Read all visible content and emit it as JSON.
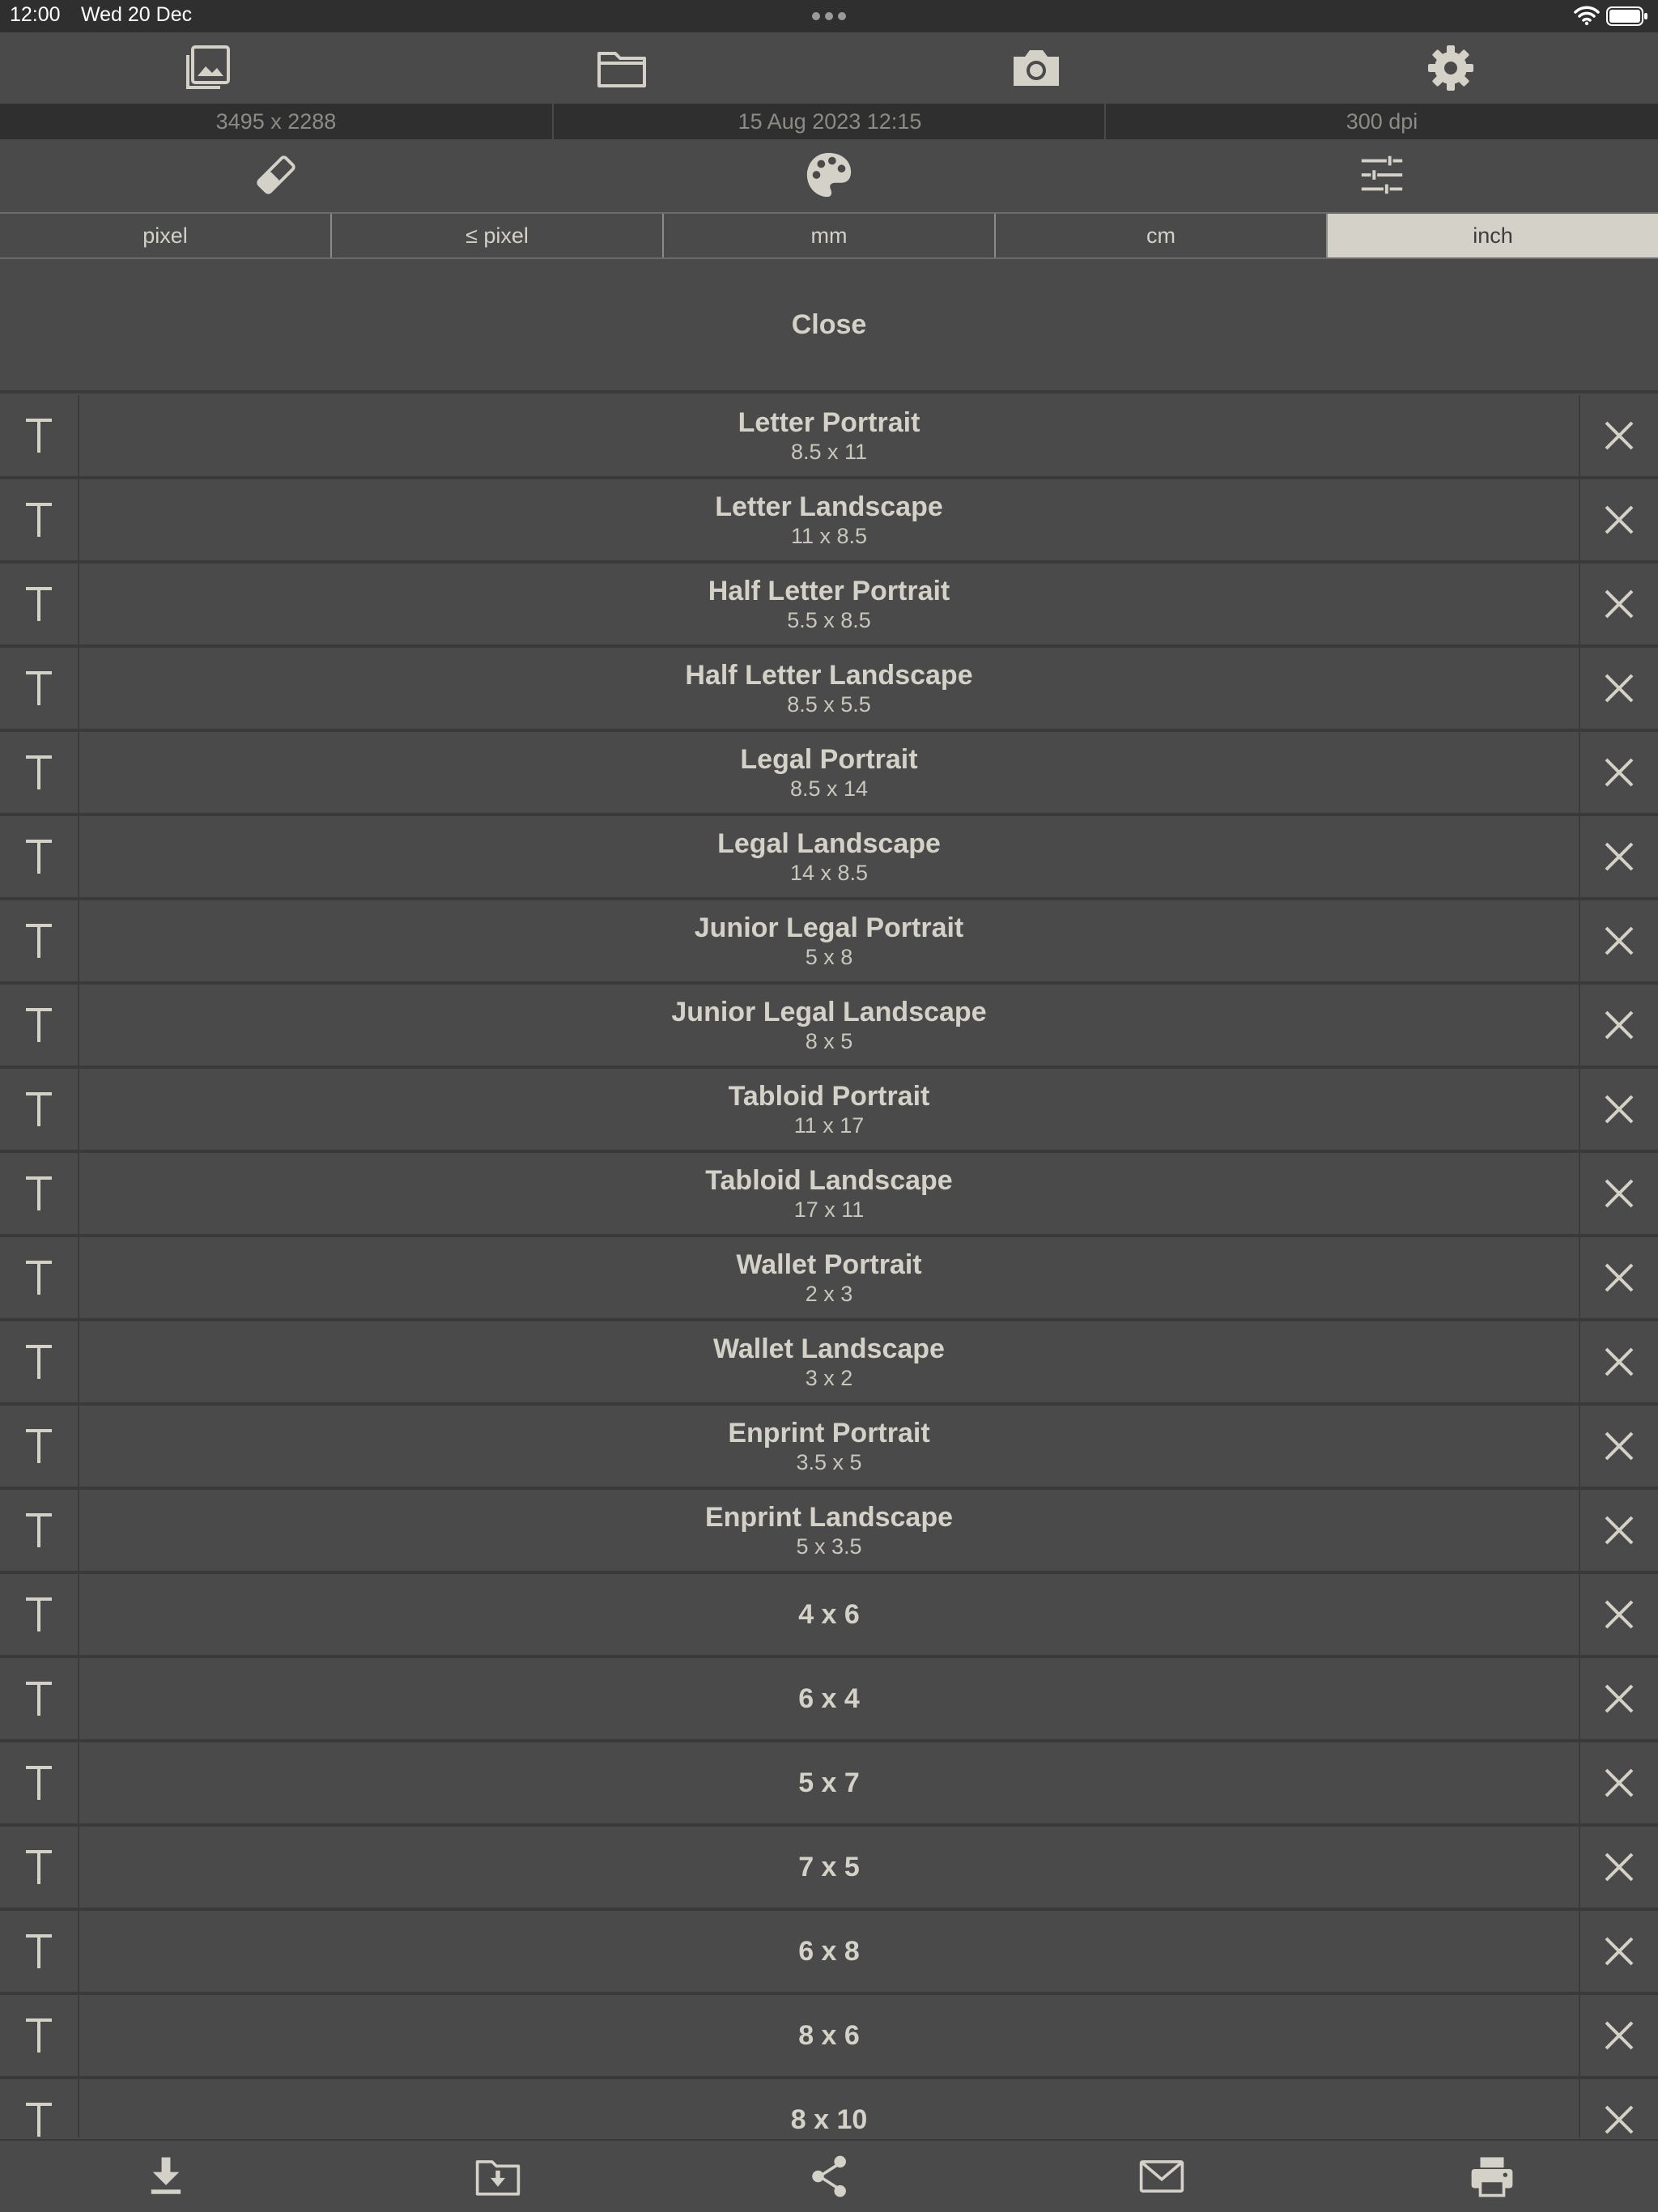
{
  "status_bar": {
    "time": "12:00",
    "date": "Wed 20 Dec"
  },
  "toolbar": {
    "icons": [
      "photo-library-icon",
      "folder-icon",
      "camera-icon",
      "settings-gear-icon"
    ]
  },
  "info_bar": {
    "dimensions": "3495 x 2288",
    "datetime": "15 Aug 2023 12:15",
    "resolution": "300 dpi"
  },
  "toolbar2": {
    "icons": [
      "eraser-icon",
      "palette-icon",
      "sliders-icon"
    ]
  },
  "units": {
    "options": [
      "pixel",
      "≤ pixel",
      "mm",
      "cm",
      "inch"
    ],
    "selected": "inch"
  },
  "close_label": "Close",
  "sizes": [
    {
      "name": "Letter Portrait",
      "dims": "8.5 x 11"
    },
    {
      "name": "Letter Landscape",
      "dims": "11 x 8.5"
    },
    {
      "name": "Half Letter Portrait",
      "dims": "5.5 x 8.5"
    },
    {
      "name": "Half Letter Landscape",
      "dims": "8.5 x 5.5"
    },
    {
      "name": "Legal Portrait",
      "dims": "8.5 x 14"
    },
    {
      "name": "Legal Landscape",
      "dims": "14 x 8.5"
    },
    {
      "name": "Junior Legal Portrait",
      "dims": "5 x 8"
    },
    {
      "name": "Junior Legal Landscape",
      "dims": "8 x 5"
    },
    {
      "name": "Tabloid Portrait",
      "dims": "11 x 17"
    },
    {
      "name": "Tabloid Landscape",
      "dims": "17 x 11"
    },
    {
      "name": "Wallet Portrait",
      "dims": "2 x 3"
    },
    {
      "name": "Wallet Landscape",
      "dims": "3 x 2"
    },
    {
      "name": "Enprint Portrait",
      "dims": "3.5 x 5"
    },
    {
      "name": "Enprint Landscape",
      "dims": "5 x 3.5"
    },
    {
      "name": "4 x 6",
      "dims": ""
    },
    {
      "name": "6 x 4",
      "dims": ""
    },
    {
      "name": "5 x 7",
      "dims": ""
    },
    {
      "name": "7 x 5",
      "dims": ""
    },
    {
      "name": "6 x 8",
      "dims": ""
    },
    {
      "name": "8 x 6",
      "dims": ""
    },
    {
      "name": "8 x 10",
      "dims": ""
    }
  ],
  "bottom_bar": {
    "icons": [
      "download-icon",
      "save-to-folder-icon",
      "share-icon",
      "mail-icon",
      "print-icon"
    ]
  },
  "colors": {
    "background": "#4a4a4a",
    "bar_dark": "#2f2f2f",
    "text": "#d4d1c8",
    "selected_segment": "#d4d1c8"
  }
}
